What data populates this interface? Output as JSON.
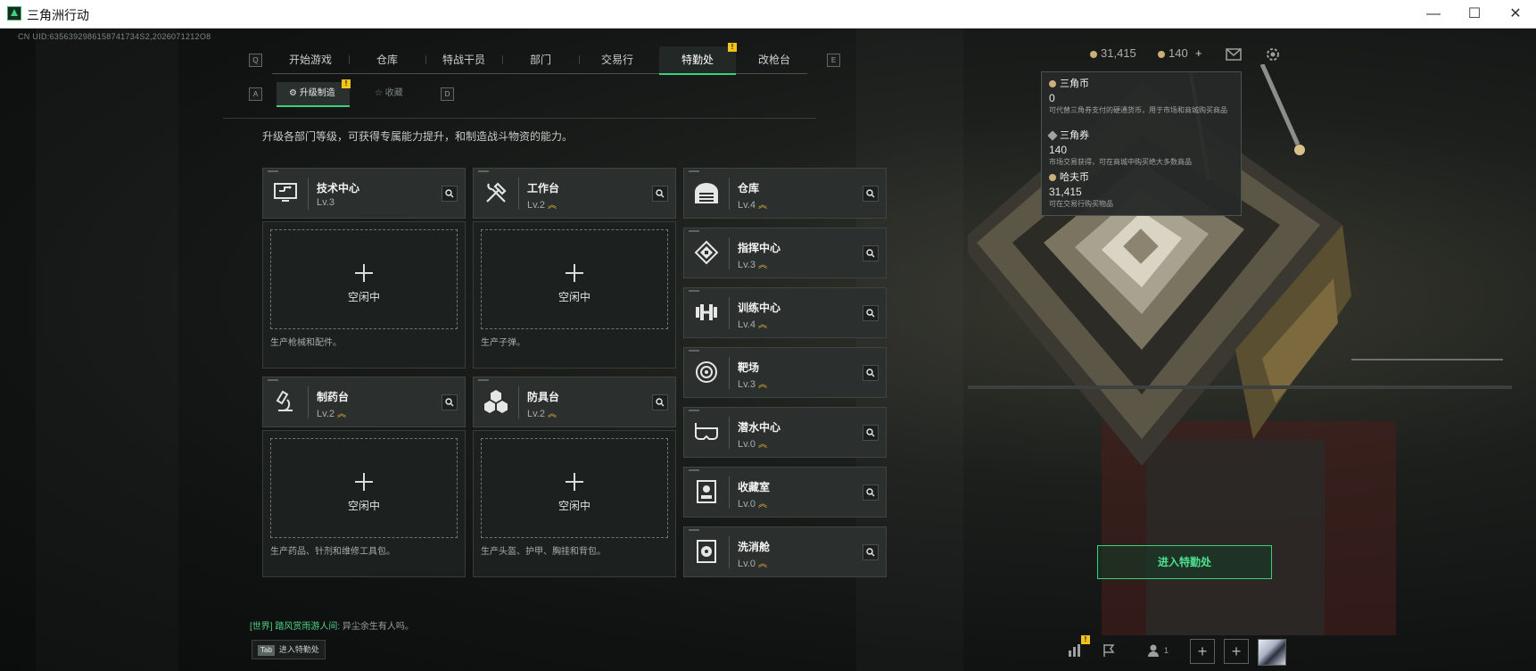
{
  "window": {
    "title": "三角洲行动",
    "minimize": "—",
    "maximize": "☐",
    "close": "✕"
  },
  "uid": "CN UID:6356392986158741734S2,2026071212O8",
  "nav": {
    "left_key": "Q",
    "right_key": "E",
    "tabs": [
      {
        "label": "开始游戏"
      },
      {
        "label": "仓库"
      },
      {
        "label": "特战干员"
      },
      {
        "label": "部门"
      },
      {
        "label": "交易行"
      },
      {
        "label": "特勤处",
        "active": true,
        "badge": "!"
      },
      {
        "label": "改枪台"
      }
    ]
  },
  "subnav": {
    "left_key": "A",
    "right_key": "D",
    "tabs": [
      {
        "label": "升级制造",
        "active": true,
        "badge": "!"
      },
      {
        "label": "收藏"
      }
    ]
  },
  "description": "升级各部门等级，可获得专属能力提升，和制造战斗物资的能力。",
  "workbenches": [
    {
      "name": "技术中心",
      "level": "Lv.3",
      "upgrade": false,
      "icon": "circuit-icon",
      "slot_status": "空闲中",
      "slot_desc": "生产枪械和配件。"
    },
    {
      "name": "工作台",
      "level": "Lv.2",
      "upgrade": true,
      "icon": "tools-icon",
      "slot_status": "空闲中",
      "slot_desc": "生产子弹。"
    },
    {
      "name": "制药台",
      "level": "Lv.2",
      "upgrade": true,
      "icon": "microscope-icon",
      "slot_status": "空闲中",
      "slot_desc": "生产药品、针剂和维修工具包。"
    },
    {
      "name": "防具台",
      "level": "Lv.2",
      "upgrade": true,
      "icon": "hexagons-icon",
      "slot_status": "空闲中",
      "slot_desc": "生产头盔、护甲、胸挂和背包。"
    }
  ],
  "facilities": [
    {
      "name": "仓库",
      "level": "Lv.4",
      "upgrade": true,
      "icon": "warehouse-icon"
    },
    {
      "name": "指挥中心",
      "level": "Lv.3",
      "upgrade": true,
      "icon": "command-icon"
    },
    {
      "name": "训练中心",
      "level": "Lv.4",
      "upgrade": true,
      "icon": "dumbbell-icon"
    },
    {
      "name": "靶场",
      "level": "Lv.3",
      "upgrade": true,
      "icon": "target-icon"
    },
    {
      "name": "潜水中心",
      "level": "Lv.0",
      "upgrade": true,
      "icon": "diving-mask-icon"
    },
    {
      "name": "收藏室",
      "level": "Lv.0",
      "upgrade": true,
      "icon": "collection-icon"
    },
    {
      "name": "洗消舱",
      "level": "Lv.0",
      "upgrade": true,
      "icon": "decontamination-icon"
    }
  ],
  "upgrade_glyph": "︽",
  "currency_bar": {
    "haf": "31,415",
    "triangle_coupon": "140",
    "plus": "+"
  },
  "currency_tooltip": [
    {
      "name": "三角币",
      "value": "0",
      "desc": "可代替三角券支付的硬通货币，用于市场和商城购买商品"
    },
    {
      "name": "三角券",
      "value": "140",
      "desc": "市场交易获得，可在商城中购买绝大多数商品"
    },
    {
      "name": "哈夫币",
      "value": "31,415",
      "desc": "可在交易行购买物品"
    }
  ],
  "enter_button": "进入特勤处",
  "chat": {
    "channel": "[世界]",
    "user": "踏风赏雨游人间",
    "message": ": 异尘余生有人吗。"
  },
  "tab_hint": {
    "key": "Tab",
    "label": "进入特勤处"
  },
  "bottom_bar": {
    "friends_count": "1",
    "stats_badge": "!"
  },
  "colors": {
    "accent": "#39d17c",
    "upgrade": "#e9b43a",
    "badge": "#f2c318",
    "card": "#2b2f2e"
  }
}
